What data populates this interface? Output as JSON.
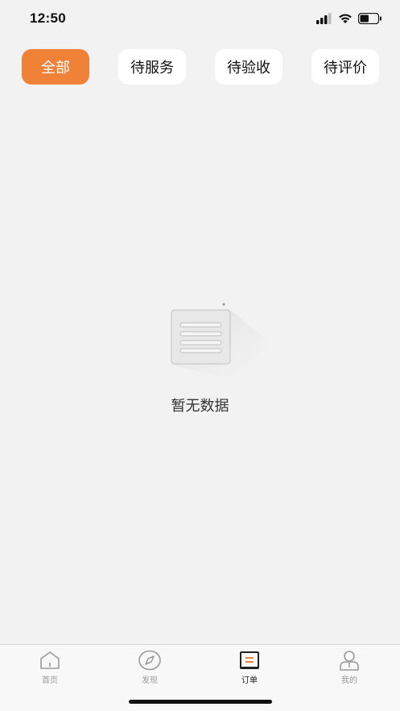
{
  "status_bar": {
    "time": "12:50",
    "icons": [
      "signal-icon",
      "wifi-icon",
      "battery-icon"
    ],
    "battery_level": 0.5
  },
  "tabs": [
    {
      "label": "全部",
      "active": true
    },
    {
      "label": "待服务",
      "active": false
    },
    {
      "label": "待验收",
      "active": false
    },
    {
      "label": "待评价",
      "active": false
    }
  ],
  "empty_state": {
    "icon": "empty-document-icon",
    "text": "暂无数据"
  },
  "tabbar": [
    {
      "label": "首页",
      "icon": "home-icon",
      "active": false
    },
    {
      "label": "发现",
      "icon": "compass-icon",
      "active": false
    },
    {
      "label": "订单",
      "icon": "order-icon",
      "active": true
    },
    {
      "label": "我的",
      "icon": "profile-icon",
      "active": false
    }
  ],
  "colors": {
    "accent": "#f08237",
    "background": "#f2f2f2",
    "tab_bg": "#ffffff",
    "tabbar_bg": "#f8f8f8"
  }
}
